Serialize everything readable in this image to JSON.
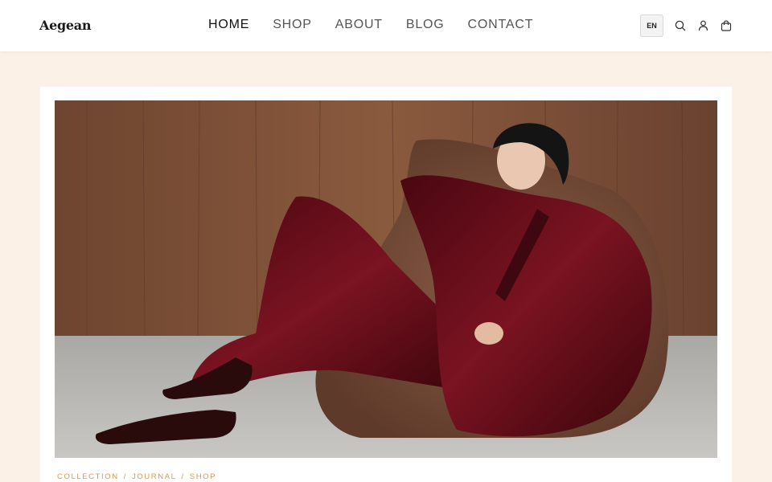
{
  "header": {
    "logo": "Aegean",
    "nav": [
      "HOME",
      "SHOP",
      "ABOUT",
      "BLOG",
      "CONTACT"
    ],
    "active_nav": "HOME",
    "language": "EN",
    "icons": [
      "search-icon",
      "user-icon",
      "cart-icon"
    ]
  },
  "breadcrumb": {
    "items": [
      "COLLECTION",
      "JOURNAL",
      "SHOP"
    ],
    "separator": "/"
  },
  "colors": {
    "page_bg": "#fcf1e7",
    "accent": "#d39a52",
    "velvet": "#6b0f1a",
    "leather": "#7a5240",
    "wood": "#7d5238"
  }
}
